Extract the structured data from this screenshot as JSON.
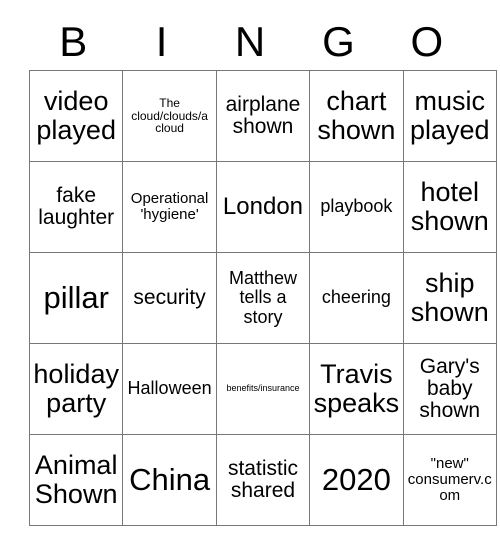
{
  "card": {
    "header": {
      "letters": [
        "B",
        "I",
        "N",
        "G",
        "O"
      ]
    },
    "rows": [
      [
        {
          "text": "video played",
          "size": "fs-xl"
        },
        {
          "text": "The cloud/clouds/a cloud",
          "size": "fs-xxs"
        },
        {
          "text": "airplane shown",
          "size": "fs-m"
        },
        {
          "text": "chart shown",
          "size": "fs-xl"
        },
        {
          "text": "music played",
          "size": "fs-xl"
        }
      ],
      [
        {
          "text": "fake laughter",
          "size": "fs-m"
        },
        {
          "text": "Operational 'hygiene'",
          "size": "fs-xs"
        },
        {
          "text": "London",
          "size": "fs-l"
        },
        {
          "text": "playbook",
          "size": "fs-s"
        },
        {
          "text": "hotel shown",
          "size": "fs-xl"
        }
      ],
      [
        {
          "text": "pillar",
          "size": "fs-xxl"
        },
        {
          "text": "security",
          "size": "fs-m"
        },
        {
          "text": "Matthew tells a story",
          "size": "fs-s"
        },
        {
          "text": "cheering",
          "size": "fs-s"
        },
        {
          "text": "ship shown",
          "size": "fs-xl"
        }
      ],
      [
        {
          "text": "holiday party",
          "size": "fs-xl"
        },
        {
          "text": "Halloween",
          "size": "fs-s"
        },
        {
          "text": "benefits/insurance",
          "size": "fs-tiny"
        },
        {
          "text": "Travis speaks",
          "size": "fs-xl"
        },
        {
          "text": "Gary's baby shown",
          "size": "fs-m"
        }
      ],
      [
        {
          "text": "Animal Shown",
          "size": "fs-xl"
        },
        {
          "text": "China",
          "size": "fs-xxl"
        },
        {
          "text": "statistic shared",
          "size": "fs-m"
        },
        {
          "text": "2020",
          "size": "fs-xxl"
        },
        {
          "text": "\"new\" consumerv.com",
          "size": "fs-xs"
        }
      ]
    ],
    "colors": {
      "background": "#ffffff",
      "text": "#000000",
      "border": "#777777"
    }
  }
}
